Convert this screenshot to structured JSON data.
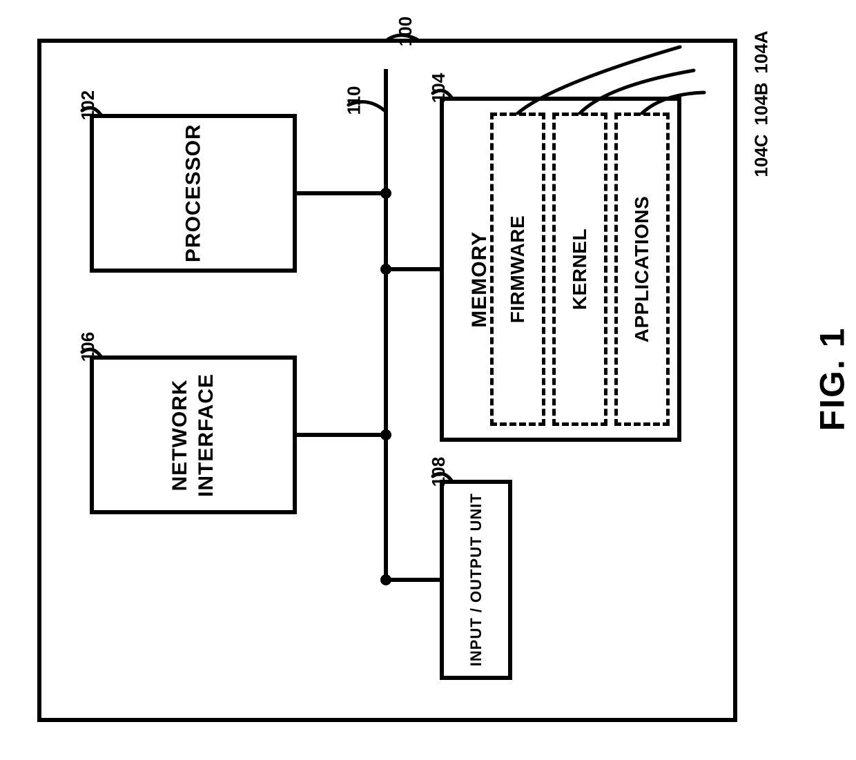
{
  "figure": {
    "caption": "FIG. 1",
    "system_ref": "100",
    "bus_ref": "110"
  },
  "blocks": {
    "processor": {
      "label": "PROCESSOR",
      "ref": "102"
    },
    "network": {
      "label_line1": "NETWORK",
      "label_line2": "INTERFACE",
      "ref": "106"
    },
    "io": {
      "label": "INPUT / OUTPUT UNIT",
      "ref": "108"
    },
    "memory": {
      "label": "MEMORY",
      "ref": "104"
    }
  },
  "memory_sub": {
    "firmware": {
      "label": "FIRMWARE",
      "ref": "104A"
    },
    "kernel": {
      "label": "KERNEL",
      "ref": "104B"
    },
    "applications": {
      "label": "APPLICATIONS",
      "ref": "104C"
    }
  }
}
